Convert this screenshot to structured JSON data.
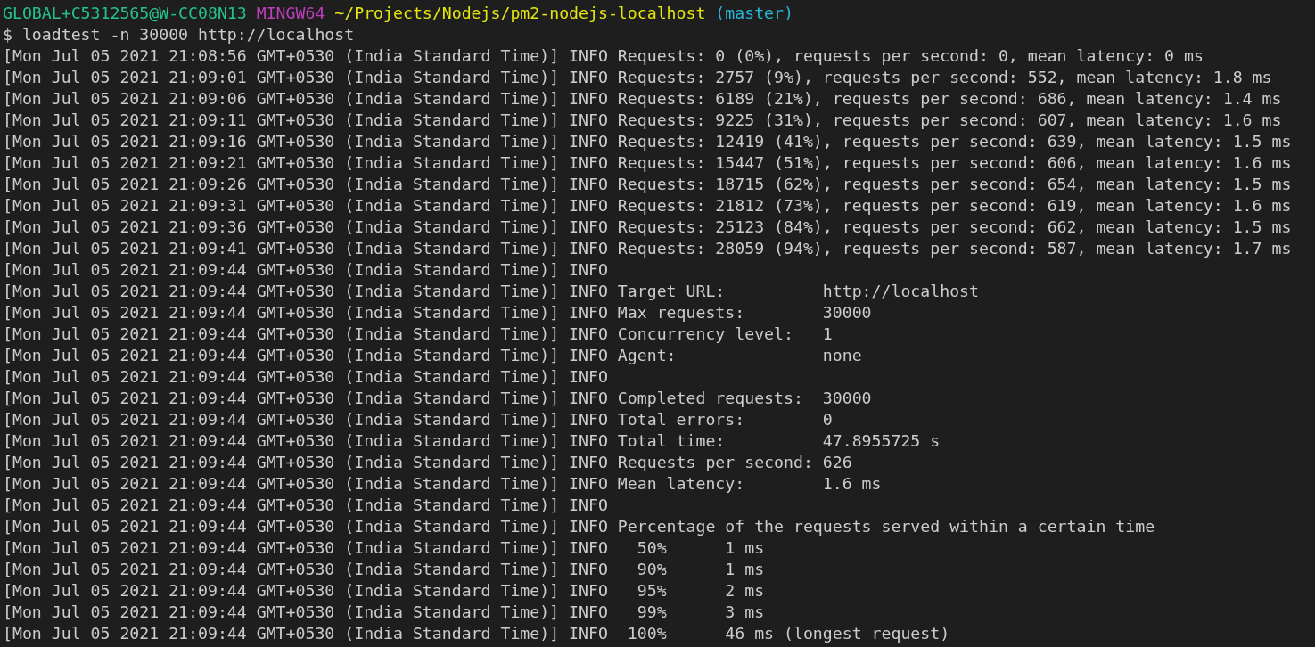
{
  "prompt": {
    "user_host": "GLOBAL+C5312565@W-CC08N13",
    "shell": "MINGW64",
    "path": "~/Projects/Nodejs/pm2-nodejs-localhost",
    "branch": "(master)"
  },
  "command": "$ loadtest -n 30000 http://localhost",
  "log_lines": [
    "[Mon Jul 05 2021 21:08:56 GMT+0530 (India Standard Time)] INFO Requests: 0 (0%), requests per second: 0, mean latency: 0 ms",
    "[Mon Jul 05 2021 21:09:01 GMT+0530 (India Standard Time)] INFO Requests: 2757 (9%), requests per second: 552, mean latency: 1.8 ms",
    "[Mon Jul 05 2021 21:09:06 GMT+0530 (India Standard Time)] INFO Requests: 6189 (21%), requests per second: 686, mean latency: 1.4 ms",
    "[Mon Jul 05 2021 21:09:11 GMT+0530 (India Standard Time)] INFO Requests: 9225 (31%), requests per second: 607, mean latency: 1.6 ms",
    "[Mon Jul 05 2021 21:09:16 GMT+0530 (India Standard Time)] INFO Requests: 12419 (41%), requests per second: 639, mean latency: 1.5 ms",
    "[Mon Jul 05 2021 21:09:21 GMT+0530 (India Standard Time)] INFO Requests: 15447 (51%), requests per second: 606, mean latency: 1.6 ms",
    "[Mon Jul 05 2021 21:09:26 GMT+0530 (India Standard Time)] INFO Requests: 18715 (62%), requests per second: 654, mean latency: 1.5 ms",
    "[Mon Jul 05 2021 21:09:31 GMT+0530 (India Standard Time)] INFO Requests: 21812 (73%), requests per second: 619, mean latency: 1.6 ms",
    "[Mon Jul 05 2021 21:09:36 GMT+0530 (India Standard Time)] INFO Requests: 25123 (84%), requests per second: 662, mean latency: 1.5 ms",
    "[Mon Jul 05 2021 21:09:41 GMT+0530 (India Standard Time)] INFO Requests: 28059 (94%), requests per second: 587, mean latency: 1.7 ms",
    "[Mon Jul 05 2021 21:09:44 GMT+0530 (India Standard Time)] INFO",
    "[Mon Jul 05 2021 21:09:44 GMT+0530 (India Standard Time)] INFO Target URL:          http://localhost",
    "[Mon Jul 05 2021 21:09:44 GMT+0530 (India Standard Time)] INFO Max requests:        30000",
    "[Mon Jul 05 2021 21:09:44 GMT+0530 (India Standard Time)] INFO Concurrency level:   1",
    "[Mon Jul 05 2021 21:09:44 GMT+0530 (India Standard Time)] INFO Agent:               none",
    "[Mon Jul 05 2021 21:09:44 GMT+0530 (India Standard Time)] INFO",
    "[Mon Jul 05 2021 21:09:44 GMT+0530 (India Standard Time)] INFO Completed requests:  30000",
    "[Mon Jul 05 2021 21:09:44 GMT+0530 (India Standard Time)] INFO Total errors:        0",
    "[Mon Jul 05 2021 21:09:44 GMT+0530 (India Standard Time)] INFO Total time:          47.8955725 s",
    "[Mon Jul 05 2021 21:09:44 GMT+0530 (India Standard Time)] INFO Requests per second: 626",
    "[Mon Jul 05 2021 21:09:44 GMT+0530 (India Standard Time)] INFO Mean latency:        1.6 ms",
    "[Mon Jul 05 2021 21:09:44 GMT+0530 (India Standard Time)] INFO",
    "[Mon Jul 05 2021 21:09:44 GMT+0530 (India Standard Time)] INFO Percentage of the requests served within a certain time",
    "[Mon Jul 05 2021 21:09:44 GMT+0530 (India Standard Time)] INFO   50%      1 ms",
    "[Mon Jul 05 2021 21:09:44 GMT+0530 (India Standard Time)] INFO   90%      1 ms",
    "[Mon Jul 05 2021 21:09:44 GMT+0530 (India Standard Time)] INFO   95%      2 ms",
    "[Mon Jul 05 2021 21:09:44 GMT+0530 (India Standard Time)] INFO   99%      3 ms",
    "[Mon Jul 05 2021 21:09:44 GMT+0530 (India Standard Time)] INFO  100%      46 ms (longest request)"
  ]
}
